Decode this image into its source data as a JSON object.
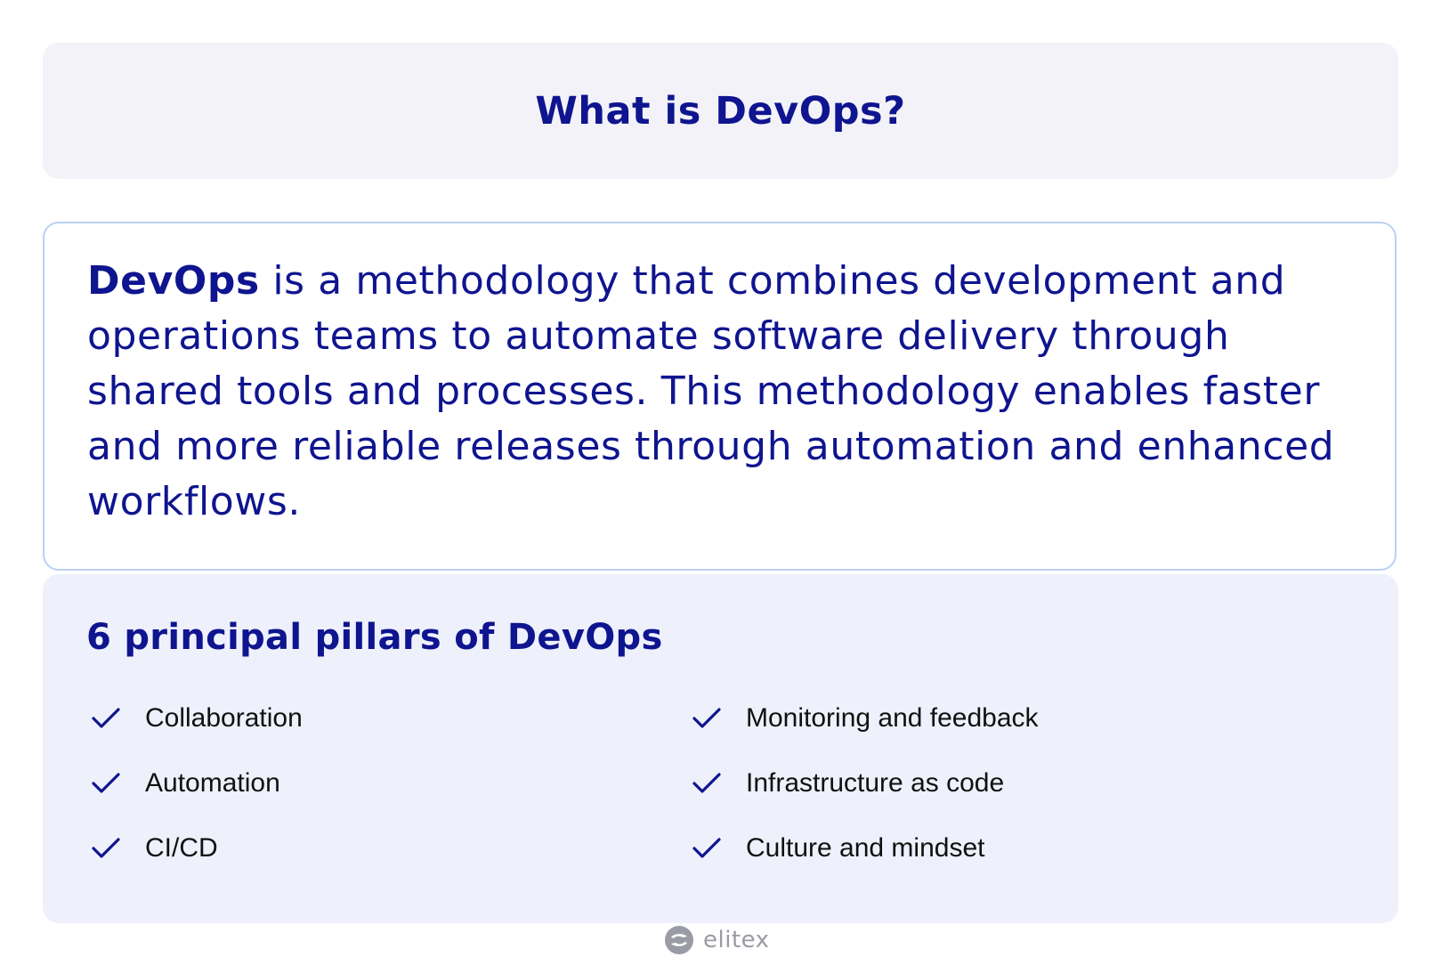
{
  "header": {
    "title": "What is DevOps?"
  },
  "definition": {
    "term": "DevOps",
    "text": " is a methodology that combines development and operations teams to automate software delivery through shared tools and processes. This methodology enables faster and more reliable releases through automation and enhanced workflows."
  },
  "pillars": {
    "heading": "6 principal pillars of DevOps",
    "left": [
      {
        "label": "Collaboration",
        "icon": "check-icon"
      },
      {
        "label": "Automation",
        "icon": "check-icon"
      },
      {
        "label": "CI/CD",
        "icon": "check-icon"
      }
    ],
    "right": [
      {
        "label": "Monitoring and feedback",
        "icon": "check-icon"
      },
      {
        "label": "Infrastructure as code",
        "icon": "check-icon"
      },
      {
        "label": "Culture and mindset",
        "icon": "check-icon"
      }
    ]
  },
  "footer": {
    "logo_text": "elitex",
    "logo_icon": "elitex-logo-icon"
  },
  "colors": {
    "accent": "#0f148f",
    "title_bg": "#f3f2f8",
    "pillars_bg": "#eef1fc",
    "border": "#bcd0f5",
    "logo": "#9a9ba4"
  }
}
